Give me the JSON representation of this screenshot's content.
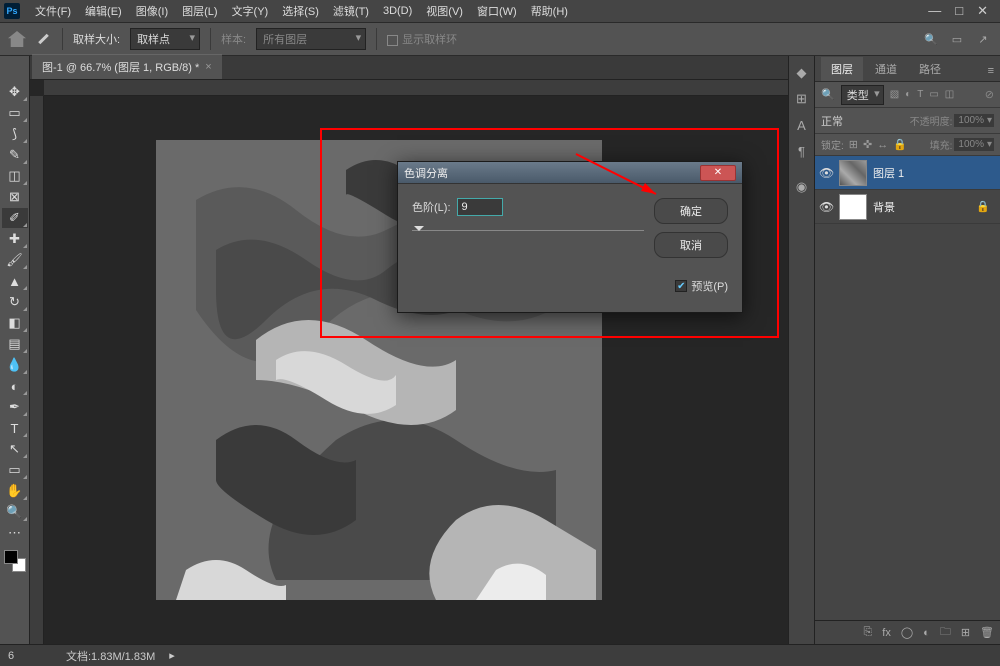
{
  "app": {
    "logo": "Ps"
  },
  "menu": [
    "文件(F)",
    "编辑(E)",
    "图像(I)",
    "图层(L)",
    "文字(Y)",
    "选择(S)",
    "滤镜(T)",
    "3D(D)",
    "视图(V)",
    "窗口(W)",
    "帮助(H)"
  ],
  "options": {
    "sample_size_label": "取样大小:",
    "sample_size_value": "取样点",
    "sample_label": "样本:",
    "sample_value": "所有图层",
    "show_ring": "显示取样环"
  },
  "doc": {
    "tab_title": "图-1 @ 66.7% (图层 1, RGB/8) *"
  },
  "panels": {
    "tabs": [
      "图层",
      "通道",
      "路径"
    ],
    "kind_label": "类型",
    "blend_mode": "正常",
    "opacity_label": "不透明度:",
    "opacity_value": "100%",
    "lock_label": "锁定:",
    "fill_label": "填充:",
    "fill_value": "100%",
    "layers": [
      {
        "name": "图层 1",
        "selected": true,
        "locked": false,
        "thumb": "camo"
      },
      {
        "name": "背景",
        "selected": false,
        "locked": true,
        "thumb": "white"
      }
    ]
  },
  "dialog": {
    "title": "色调分离",
    "levels_label": "色阶(L):",
    "levels_value": "9",
    "ok": "确定",
    "cancel": "取消",
    "preview": "预览(P)"
  },
  "status": {
    "zoom": "6",
    "doc_info": "文档:1.83M/1.83M"
  }
}
